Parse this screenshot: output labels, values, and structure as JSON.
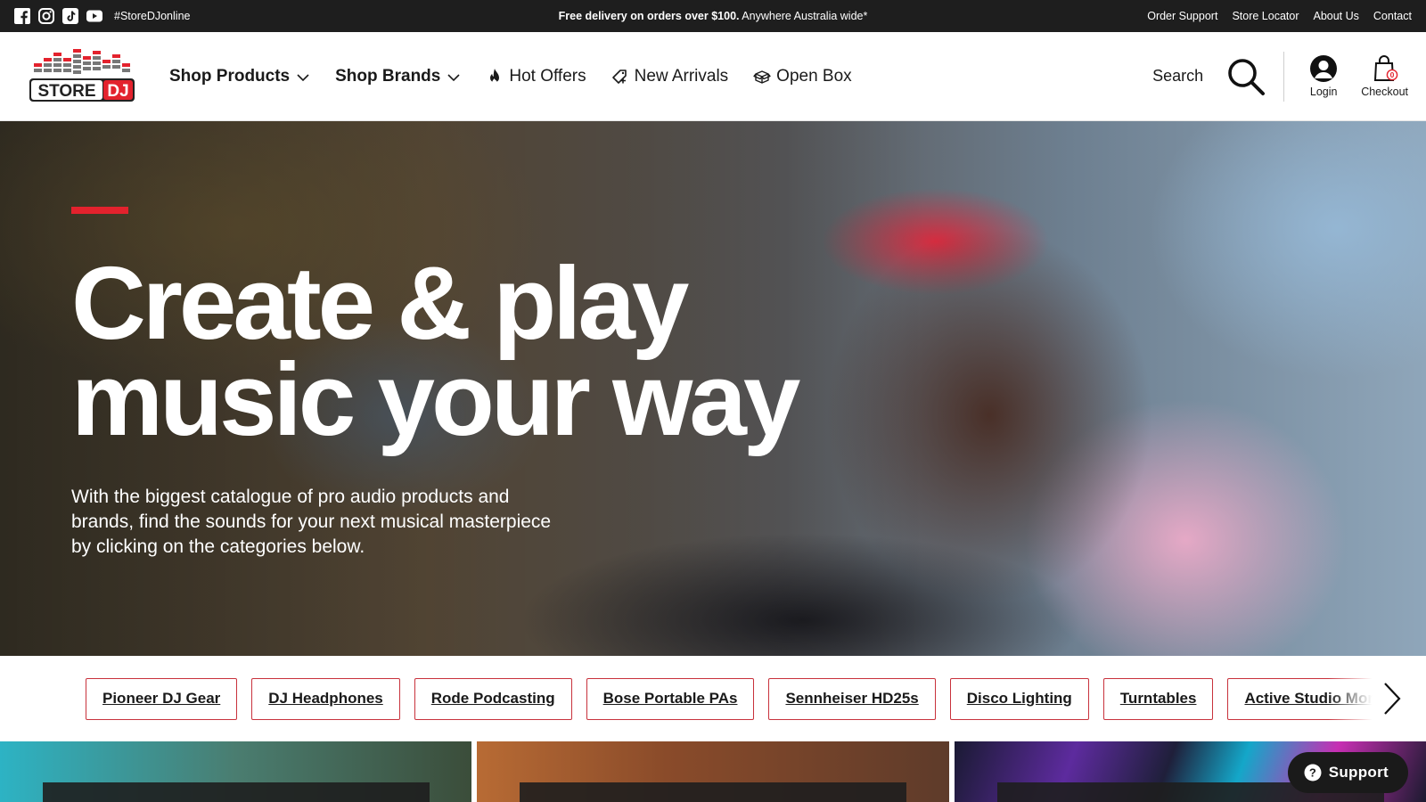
{
  "topbar": {
    "socials": [
      {
        "icon": "facebook-icon"
      },
      {
        "icon": "instagram-icon"
      },
      {
        "icon": "tiktok-icon"
      },
      {
        "icon": "youtube-icon"
      }
    ],
    "hashtag": "#StoreDJonline",
    "promo_bold": "Free delivery on orders over $100.",
    "promo_rest": " Anywhere Australia wide*",
    "links": [
      "Order Support",
      "Store Locator",
      "About Us",
      "Contact"
    ]
  },
  "header": {
    "logo_text": "STORE DJ",
    "nav": [
      {
        "label": "Shop Products",
        "icon": "chevron-down-icon"
      },
      {
        "label": "Shop Brands",
        "icon": "chevron-down-icon"
      },
      {
        "label": "Hot Offers",
        "icon": "flame-icon"
      },
      {
        "label": "New Arrivals",
        "icon": "tag-plus-icon"
      },
      {
        "label": "Open Box",
        "icon": "open-box-icon"
      }
    ],
    "search_label": "Search",
    "login_label": "Login",
    "checkout_label": "Checkout",
    "cart_count": "0"
  },
  "hero": {
    "title_line1": "Create & play",
    "title_line2": "music your way",
    "subtitle": "With the biggest catalogue of pro audio products and brands, find the sounds for your next musical masterpiece by clicking on the categories below."
  },
  "categories": [
    "Pioneer DJ Gear",
    "DJ Headphones",
    "Rode Podcasting",
    "Bose Portable PAs",
    "Sennheiser HD25s",
    "Disco Lighting",
    "Turntables",
    "Active Studio Monitors"
  ],
  "support": {
    "label": "Support"
  },
  "colors": {
    "accent": "#e3222d",
    "topbar": "#1e1e1e",
    "chip_border": "#c8323c"
  }
}
